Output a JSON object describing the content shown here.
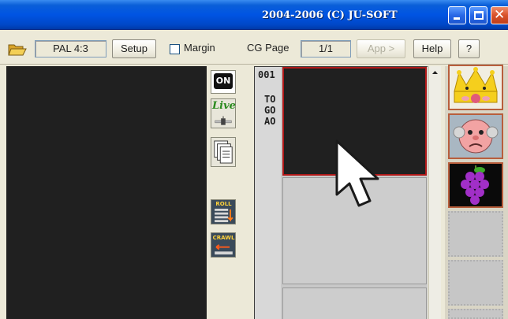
{
  "window": {
    "title": "2004-2006 (C) JU-SOFT"
  },
  "toolbar": {
    "format_value": "PAL 4:3",
    "setup_label": "Setup",
    "margin_label": "Margin",
    "cg_page_label": "CG Page",
    "cg_page_value": "1/1",
    "app_label": "App >",
    "help_label": "Help",
    "question_label": "?"
  },
  "tools": {
    "on_label": "ON",
    "live_label": "Live",
    "roll_label": "ROLL",
    "crawl_label": "CRAWL"
  },
  "page_list": {
    "number": "001",
    "codes": [
      "TO",
      "GO",
      "AO"
    ]
  },
  "colors": {
    "accent": "#0054e3",
    "selected_border": "#b01818",
    "preview_bg": "#202020"
  }
}
